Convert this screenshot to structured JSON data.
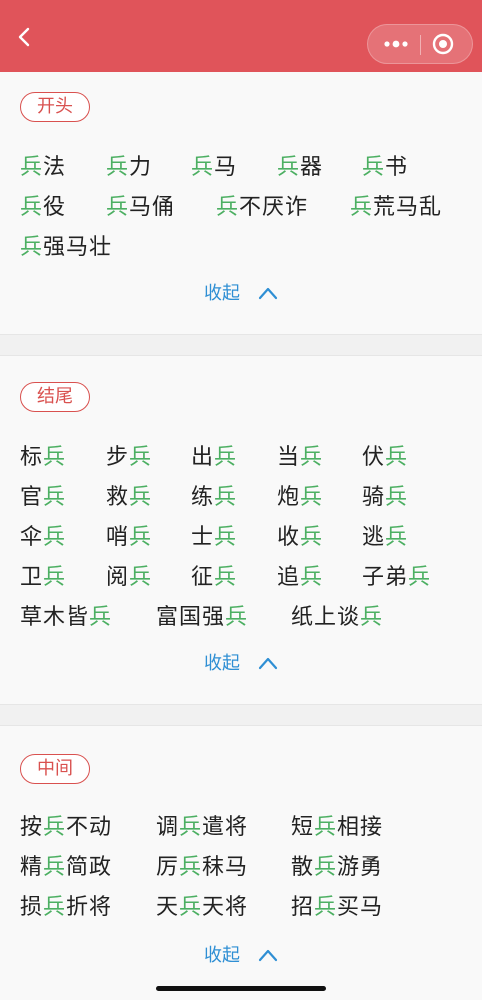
{
  "colors": {
    "topbar": "#e0545a",
    "accent_red": "#d9514f",
    "highlight_green": "#4caf62",
    "link_blue": "#2f8fd4"
  },
  "icons": {
    "back": "chevron-left-icon",
    "more": "more-dots-icon",
    "close": "target-close-icon",
    "collapse": "chevron-up-icon"
  },
  "sections": [
    {
      "tag": "开头",
      "collapse_label": "收起",
      "words": [
        {
          "pre": "",
          "hi": "兵",
          "post": "法"
        },
        {
          "pre": "",
          "hi": "兵",
          "post": "力"
        },
        {
          "pre": "",
          "hi": "兵",
          "post": "马"
        },
        {
          "pre": "",
          "hi": "兵",
          "post": "器"
        },
        {
          "pre": "",
          "hi": "兵",
          "post": "书"
        },
        {
          "pre": "",
          "hi": "兵",
          "post": "役"
        },
        {
          "pre": "",
          "hi": "兵",
          "post": "马俑"
        },
        {
          "pre": "",
          "hi": "兵",
          "post": "不厌诈"
        },
        {
          "pre": "",
          "hi": "兵",
          "post": "荒马乱"
        },
        {
          "pre": "",
          "hi": "兵",
          "post": "强马壮"
        }
      ]
    },
    {
      "tag": "结尾",
      "collapse_label": "收起",
      "words": [
        {
          "pre": "标",
          "hi": "兵",
          "post": ""
        },
        {
          "pre": "步",
          "hi": "兵",
          "post": ""
        },
        {
          "pre": "出",
          "hi": "兵",
          "post": ""
        },
        {
          "pre": "当",
          "hi": "兵",
          "post": ""
        },
        {
          "pre": "伏",
          "hi": "兵",
          "post": ""
        },
        {
          "pre": "官",
          "hi": "兵",
          "post": ""
        },
        {
          "pre": "救",
          "hi": "兵",
          "post": ""
        },
        {
          "pre": "练",
          "hi": "兵",
          "post": ""
        },
        {
          "pre": "炮",
          "hi": "兵",
          "post": ""
        },
        {
          "pre": "骑",
          "hi": "兵",
          "post": ""
        },
        {
          "pre": "伞",
          "hi": "兵",
          "post": ""
        },
        {
          "pre": "哨",
          "hi": "兵",
          "post": ""
        },
        {
          "pre": "士",
          "hi": "兵",
          "post": ""
        },
        {
          "pre": "收",
          "hi": "兵",
          "post": ""
        },
        {
          "pre": "逃",
          "hi": "兵",
          "post": ""
        },
        {
          "pre": "卫",
          "hi": "兵",
          "post": ""
        },
        {
          "pre": "阅",
          "hi": "兵",
          "post": ""
        },
        {
          "pre": "征",
          "hi": "兵",
          "post": ""
        },
        {
          "pre": "追",
          "hi": "兵",
          "post": ""
        },
        {
          "pre": "子弟",
          "hi": "兵",
          "post": ""
        },
        {
          "pre": "草木皆",
          "hi": "兵",
          "post": ""
        },
        {
          "pre": "富国强",
          "hi": "兵",
          "post": ""
        },
        {
          "pre": "纸上谈",
          "hi": "兵",
          "post": ""
        }
      ]
    },
    {
      "tag": "中间",
      "collapse_label": "收起",
      "words": [
        {
          "pre": "按",
          "hi": "兵",
          "post": "不动"
        },
        {
          "pre": "调",
          "hi": "兵",
          "post": "遣将"
        },
        {
          "pre": "短",
          "hi": "兵",
          "post": "相接"
        },
        {
          "pre": "精",
          "hi": "兵",
          "post": "简政"
        },
        {
          "pre": "厉",
          "hi": "兵",
          "post": "秣马"
        },
        {
          "pre": "散",
          "hi": "兵",
          "post": "游勇"
        },
        {
          "pre": "损",
          "hi": "兵",
          "post": "折将"
        },
        {
          "pre": "天",
          "hi": "兵",
          "post": "天将"
        },
        {
          "pre": "招",
          "hi": "兵",
          "post": "买马"
        }
      ]
    }
  ]
}
